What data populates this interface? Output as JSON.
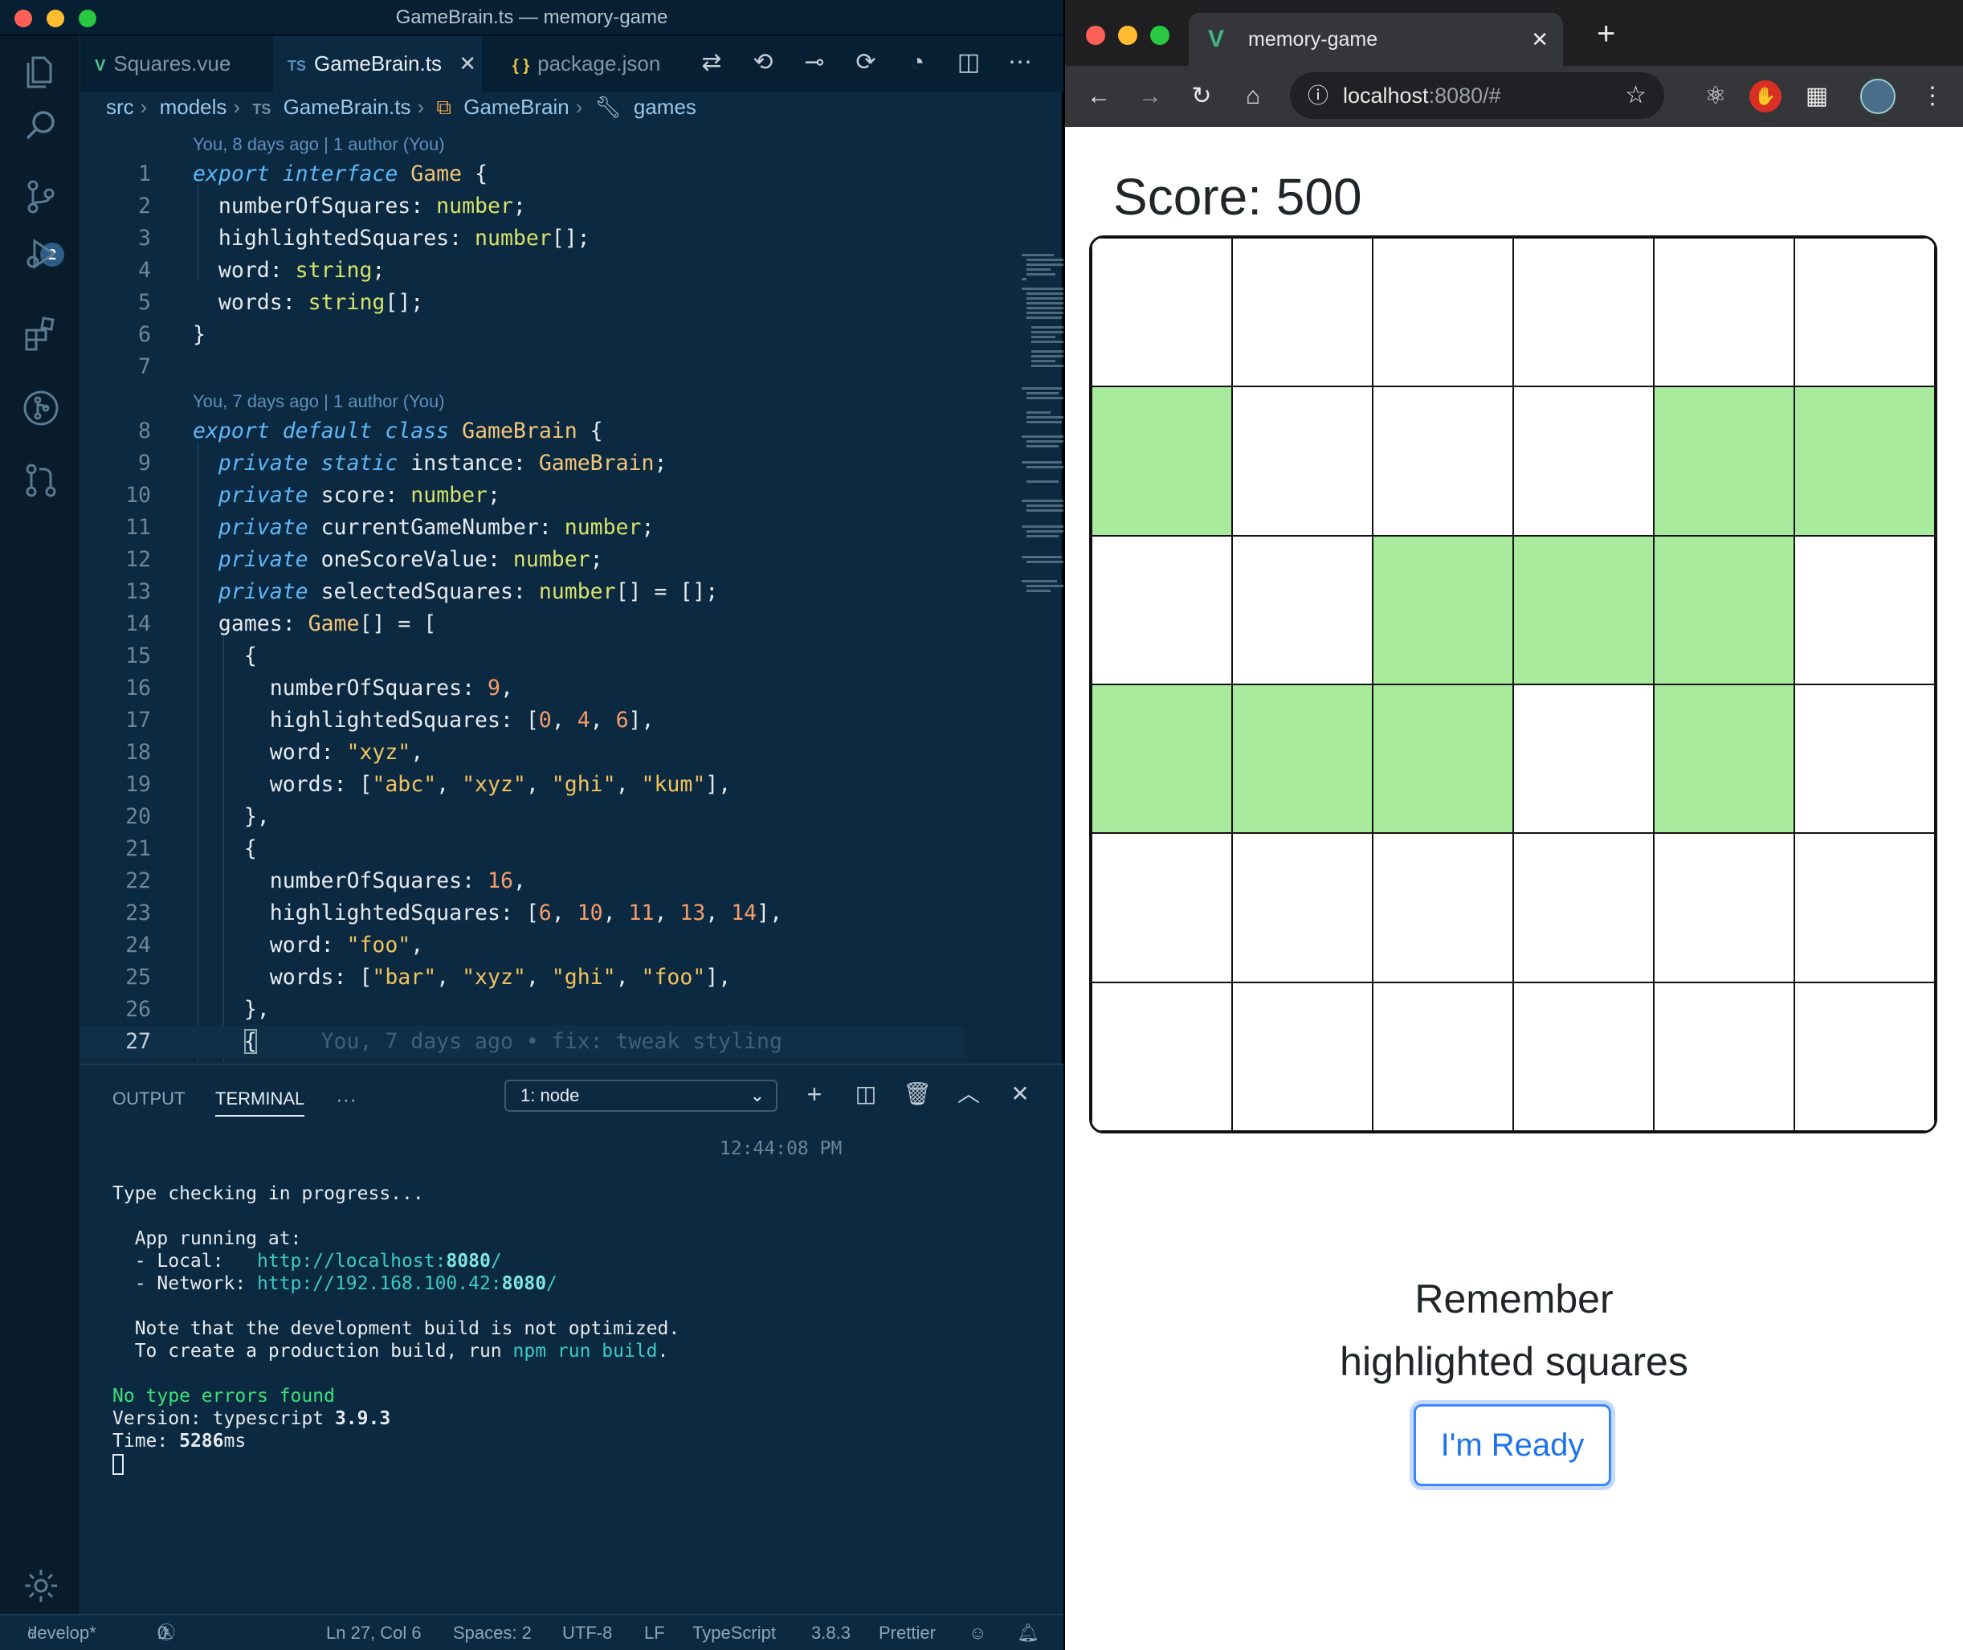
{
  "vscode": {
    "window_title": "GameBrain.ts — memory-game",
    "source_control_badge": "2",
    "tabs": [
      {
        "icon": "V",
        "label": "Squares.vue"
      },
      {
        "icon": "TS",
        "label": "GameBrain.ts"
      },
      {
        "icon": "{ }",
        "label": "package.json"
      }
    ],
    "breadcrumb": [
      "src",
      "models",
      "GameBrain.ts",
      "GameBrain",
      "games"
    ],
    "breadcrumb_file_icon": "TS",
    "blame": {
      "b1": "You, 8 days ago | 1 author (You)",
      "b2": "You, 7 days ago | 1 author (You)",
      "inline": "You, 7 days ago • fix: tweak styling"
    },
    "line_numbers": [
      "1",
      "2",
      "3",
      "4",
      "5",
      "6",
      "7",
      "8",
      "9",
      "10",
      "11",
      "12",
      "13",
      "14",
      "15",
      "16",
      "17",
      "18",
      "19",
      "20",
      "21",
      "22",
      "23",
      "24",
      "25",
      "26",
      "27"
    ],
    "code": {
      "export": "export",
      "interface": "interface",
      "default": "default",
      "class": "class",
      "private": "private",
      "static": "static",
      "Game": "Game",
      "GameBrain": "GameBrain",
      "number": "number",
      "string": "string",
      "numberOfSquares": "numberOfSquares",
      "highlightedSquares": "highlightedSquares",
      "word": "word",
      "words": "words",
      "instance": "instance",
      "score": "score",
      "currentGameNumber": "currentGameNumber",
      "oneScoreValue": "oneScoreValue",
      "selectedSquares": "selectedSquares",
      "games": "games",
      "n9": "9",
      "n0": "0",
      "n4": "4",
      "n6": "6",
      "n16": "16",
      "n10": "10",
      "n11": "11",
      "n13": "13",
      "n14": "14",
      "s_xyz": "\"xyz\"",
      "s_abc": "\"abc\"",
      "s_ghi": "\"ghi\"",
      "s_kum": "\"kum\"",
      "s_foo": "\"foo\"",
      "s_bar": "\"bar\""
    },
    "panel": {
      "tabs": [
        "OUTPUT",
        "TERMINAL"
      ],
      "more": "···",
      "terminal_select": "1: node",
      "timestamp": "12:44:08 PM",
      "lines": {
        "t1": "Type checking in progress...",
        "t2": "  App running at:",
        "t3a": "  - Local:   ",
        "t3b": "http://localhost:",
        "t3c": "8080",
        "t3d": "/",
        "t4a": "  - Network: ",
        "t4b": "http://192.168.100.42:",
        "t4c": "8080",
        "t4d": "/",
        "t5": "  Note that the development build is not optimized.",
        "t6a": "  To create a production build, run ",
        "t6b": "npm run build",
        "t6c": ".",
        "t7": "No type errors found",
        "t8a": "Version: typescript ",
        "t8b": "3.9.3",
        "t9a": "Time: ",
        "t9b": "5286",
        "t9c": "ms"
      }
    },
    "status": {
      "branch": "develop*",
      "errors": "0",
      "warnings": "0",
      "position": "Ln 27, Col 6",
      "spaces": "Spaces: 2",
      "encoding": "UTF-8",
      "eol": "LF",
      "language": "TypeScript",
      "ts_version": "3.8.3",
      "formatter": "Prettier"
    }
  },
  "browser": {
    "tab_title": "memory-game",
    "url_host": "localhost",
    "url_rest": ":8080/#",
    "score_label": "Score: 500",
    "grid_highlighted": [
      6,
      10,
      11,
      14,
      15,
      16,
      18,
      19,
      20,
      22
    ],
    "grid_size": 6,
    "message": "Remember highlighted squares",
    "button_label": "I'm Ready",
    "colors": {
      "highlight": "#a8eb9d",
      "button": "#1d74e8"
    }
  }
}
